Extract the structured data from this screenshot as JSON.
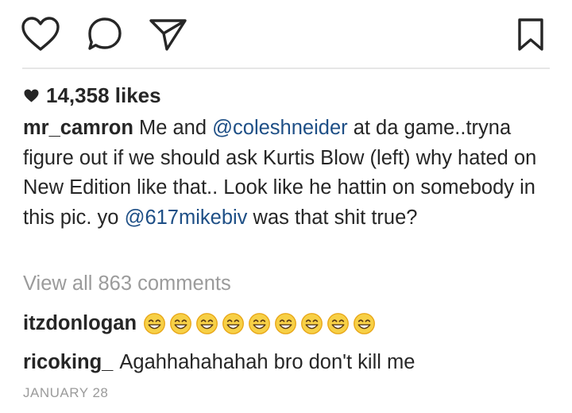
{
  "actions": {
    "like_icon": "heart-outline-icon",
    "comment_icon": "comment-bubble-icon",
    "share_icon": "paper-plane-icon",
    "save_icon": "bookmark-icon"
  },
  "likes": {
    "icon": "heart-filled-icon",
    "text": "14,358 likes"
  },
  "caption": {
    "username": "mr_camron",
    "segments": [
      {
        "type": "text",
        "text": " Me and "
      },
      {
        "type": "mention",
        "text": "@coleshneider"
      },
      {
        "type": "text",
        "text": " at da game..tryna figure out if we should ask Kurtis Blow (left) why hated on New Edition like that.. Look like he hattin on somebody in this pic. yo "
      },
      {
        "type": "mention",
        "text": "@617mikebiv"
      },
      {
        "type": "text",
        "text": " was that shit true?"
      }
    ]
  },
  "view_all_comments": "View all 863 comments",
  "comments": [
    {
      "username": "itzdonlogan",
      "text": "",
      "emoji": "grinning-face-with-smiling-eyes",
      "emoji_count": 9
    },
    {
      "username": "ricoking_",
      "text": "Agahhahahahah bro don't kill me"
    }
  ],
  "date": "JANUARY 28",
  "colors": {
    "text": "#262626",
    "mention": "#1e4f86",
    "muted": "#9b9b9b",
    "divider": "#e6e6e6",
    "emoji_face": "#f7d046",
    "emoji_outline": "#e8a617"
  }
}
